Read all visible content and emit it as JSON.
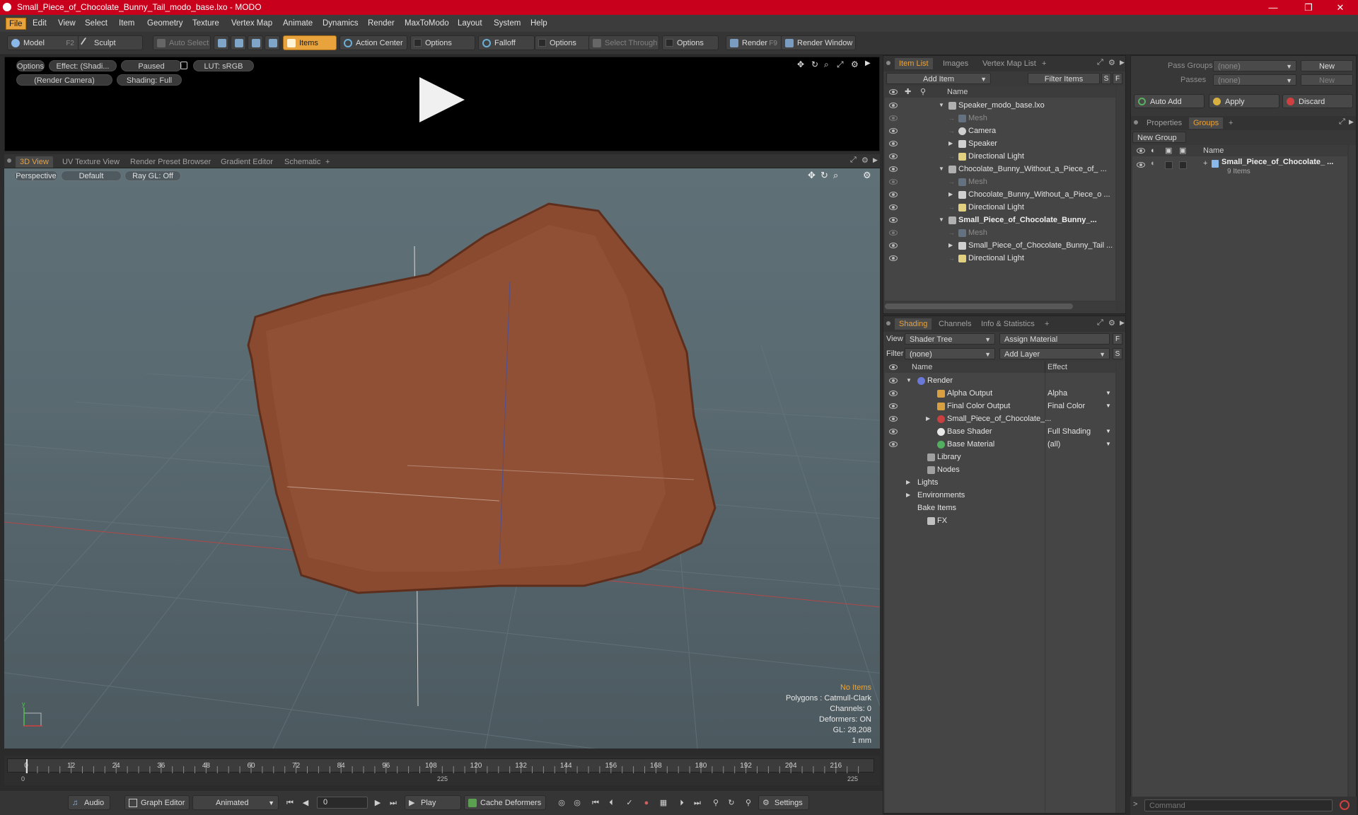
{
  "window": {
    "title": "Small_Piece_of_Chocolate_Bunny_Tail_modo_base.lxo - MODO",
    "controls": [
      "—",
      "❐",
      "✕"
    ]
  },
  "menubar": [
    "File",
    "Edit",
    "View",
    "Select",
    "Item",
    "Geometry",
    "Texture",
    "Vertex Map",
    "Animate",
    "Dynamics",
    "Render",
    "MaxToModo",
    "Layout",
    "System",
    "Help"
  ],
  "toolbar": {
    "model": "Model",
    "model_key": "F2",
    "sculpt": "Sculpt",
    "auto_select": "Auto Select",
    "items": "Items",
    "action_center": "Action Center",
    "options1": "Options",
    "falloff": "Falloff",
    "options2": "Options",
    "select_through": "Select Through",
    "options3": "Options",
    "render": "Render",
    "render_key": "F9",
    "render_window": "Render Window"
  },
  "preview": {
    "options": "Options",
    "effect": "Effect: (Shadi...",
    "paused": "Paused",
    "lut": "LUT: sRGB",
    "camera": "(Render Camera)",
    "shading": "Shading: Full"
  },
  "viewport_tabs": [
    "3D View",
    "UV Texture View",
    "Render Preset Browser",
    "Gradient Editor",
    "Schematic",
    "+"
  ],
  "viewport": {
    "projection": "Perspective",
    "style": "Default",
    "raygl": "Ray GL: Off",
    "hud": {
      "no_items": "No Items",
      "polygons": "Polygons : Catmull-Clark",
      "channels": "Channels: 0",
      "deformers": "Deformers: ON",
      "gl": "GL: 28,208",
      "scale": "1 mm"
    }
  },
  "timeline": {
    "ticks": [
      "0",
      "12",
      "24",
      "36",
      "48",
      "60",
      "72",
      "84",
      "96",
      "108",
      "120",
      "132",
      "144",
      "156",
      "168",
      "180",
      "192",
      "204",
      "216"
    ],
    "start": "0",
    "mid": "225",
    "end": "225"
  },
  "bottombar": {
    "audio": "Audio",
    "graph_editor": "Graph Editor",
    "animated": "Animated",
    "frame": "0",
    "play": "Play",
    "cache_deformers": "Cache Deformers",
    "settings": "Settings"
  },
  "item_list": {
    "tabs": [
      "Item List",
      "Images",
      "Vertex Map List",
      "+"
    ],
    "add_item": "Add Item",
    "filter_items": "Filter Items",
    "s_btn": "S",
    "f_btn": "F",
    "col_name": "Name",
    "rows": [
      {
        "label": "Speaker_modo_base.lxo",
        "depth": 0,
        "expand": "▼",
        "icon": "scene",
        "style": ""
      },
      {
        "label": "Mesh",
        "depth": 1,
        "expand": "",
        "icon": "mesh",
        "style": "dim"
      },
      {
        "label": "Camera",
        "depth": 1,
        "expand": "",
        "icon": "camera",
        "style": ""
      },
      {
        "label": "Speaker",
        "depth": 1,
        "expand": "▶",
        "icon": "group",
        "style": ""
      },
      {
        "label": "Directional Light",
        "depth": 1,
        "expand": "",
        "icon": "light",
        "style": ""
      },
      {
        "label": "Chocolate_Bunny_Without_a_Piece_of_ ...",
        "depth": 0,
        "expand": "▼",
        "icon": "scene",
        "style": ""
      },
      {
        "label": "Mesh",
        "depth": 1,
        "expand": "",
        "icon": "mesh",
        "style": "dim"
      },
      {
        "label": "Chocolate_Bunny_Without_a_Piece_o ...",
        "depth": 1,
        "expand": "▶",
        "icon": "group",
        "style": ""
      },
      {
        "label": "Directional Light",
        "depth": 1,
        "expand": "",
        "icon": "light",
        "style": ""
      },
      {
        "label": "Small_Piece_of_Chocolate_Bunny_...",
        "depth": 0,
        "expand": "▼",
        "icon": "scene",
        "style": "bold"
      },
      {
        "label": "Mesh",
        "depth": 1,
        "expand": "",
        "icon": "mesh",
        "style": "dim"
      },
      {
        "label": "Small_Piece_of_Chocolate_Bunny_Tail ...",
        "depth": 1,
        "expand": "▶",
        "icon": "group",
        "style": ""
      },
      {
        "label": "Directional Light",
        "depth": 1,
        "expand": "",
        "icon": "light",
        "style": ""
      }
    ]
  },
  "shading": {
    "tabs": [
      "Shading",
      "Channels",
      "Info & Statistics",
      "+"
    ],
    "view_label": "View",
    "view_value": "Shader Tree",
    "assign_material": "Assign Material",
    "filter_label": "Filter",
    "filter_value": "(none)",
    "add_layer": "Add Layer",
    "f_btn": "F",
    "s_btn": "S",
    "col_name": "Name",
    "col_effect": "Effect",
    "rows": [
      {
        "label": "Render",
        "effect": "",
        "depth": 0,
        "expand": "▼",
        "icon": "render",
        "eye": true
      },
      {
        "label": "Alpha Output",
        "effect": "Alpha",
        "depth": 1,
        "expand": "",
        "icon": "output",
        "eye": true
      },
      {
        "label": "Final Color Output",
        "effect": "Final Color",
        "depth": 1,
        "expand": "",
        "icon": "output",
        "eye": true
      },
      {
        "label": "Small_Piece_of_Chocolate_...",
        "effect": "",
        "depth": 1,
        "expand": "▶",
        "icon": "material",
        "eye": true
      },
      {
        "label": "Base Shader",
        "effect": "Full Shading",
        "depth": 1,
        "expand": "",
        "icon": "shader",
        "eye": true
      },
      {
        "label": "Base Material",
        "effect": "(all)",
        "depth": 1,
        "expand": "",
        "icon": "basemat",
        "eye": true
      },
      {
        "label": "Library",
        "effect": "",
        "depth": 0.5,
        "expand": "",
        "icon": "folder",
        "eye": false
      },
      {
        "label": "Nodes",
        "effect": "",
        "depth": 0.5,
        "expand": "",
        "icon": "folder",
        "eye": false
      },
      {
        "label": "Lights",
        "effect": "",
        "depth": 0,
        "expand": "▶",
        "icon": "",
        "eye": false
      },
      {
        "label": "Environments",
        "effect": "",
        "depth": 0,
        "expand": "▶",
        "icon": "",
        "eye": false
      },
      {
        "label": "Bake Items",
        "effect": "",
        "depth": 0,
        "expand": "",
        "icon": "",
        "eye": false
      },
      {
        "label": "FX",
        "effect": "",
        "depth": 0.5,
        "expand": "",
        "icon": "fx",
        "eye": false
      }
    ]
  },
  "groups_panel": {
    "pass_groups_label": "Pass Groups",
    "pass_groups_value": "(none)",
    "new_btn": "New",
    "passes_label": "Passes",
    "passes_value": "(none)",
    "new_btn2": "New",
    "auto_add": "Auto Add",
    "apply": "Apply",
    "discard": "Discard",
    "tabs": [
      "Properties",
      "Groups",
      "+"
    ],
    "new_group": "New Group",
    "col_name": "Name",
    "group_name": "Small_Piece_of_Chocolate_ ...",
    "group_count": "9 Items"
  },
  "command": {
    "placeholder": "Command",
    "prompt": ">"
  },
  "colors": {
    "accent": "#e8a33d",
    "titlebar": "#c8001c",
    "chocolate": "#8a4a30"
  }
}
